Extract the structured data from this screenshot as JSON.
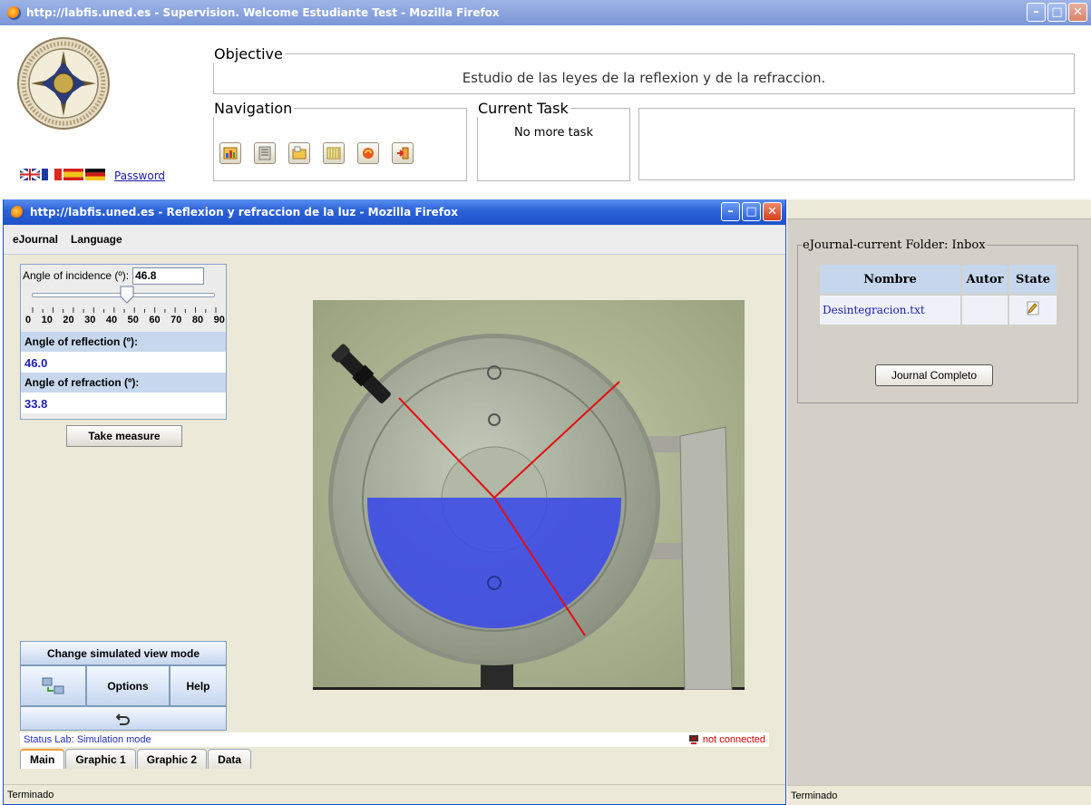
{
  "main_window": {
    "title": "http://labfis.uned.es - Supervision. Welcome Estudiante Test - Mozilla Firefox",
    "password_link": "Password",
    "languages": [
      "en-flag-icon",
      "fr-flag-icon",
      "es-flag-icon",
      "de-flag-icon"
    ],
    "objective": {
      "legend": "Objective",
      "text": "Estudio de las leyes de la reflexion y de la refraccion."
    },
    "navigation": {
      "legend": "Navigation",
      "icons": [
        "lab-icon",
        "document-icon",
        "folder-icon",
        "columns-icon",
        "refresh-icon",
        "exit-icon"
      ]
    },
    "current_task": {
      "legend": "Current Task",
      "text": "No more task"
    },
    "status": "Terminado"
  },
  "lab_window": {
    "title": "http://labfis.uned.es - Reflexion y refraccion de la luz - Mozilla Firefox",
    "menu": [
      "eJournal",
      "Language"
    ],
    "incidence": {
      "label": "Angle of incidence (º):",
      "value": "46.8",
      "slider_min": 0,
      "slider_max": 90,
      "slider_value": 46.8,
      "ticks": [
        "0",
        "10",
        "20",
        "30",
        "40",
        "50",
        "60",
        "70",
        "80",
        "90"
      ]
    },
    "reflection": {
      "label": "Angle of reflection (º):",
      "value": "46.0"
    },
    "refraction": {
      "label": "Angle of refraction (º):",
      "value": "33.8"
    },
    "take_measure": "Take measure",
    "change_view": "Change simulated view mode",
    "options": "Options",
    "help": "Help",
    "status_lab": "Status Lab: Simulation mode",
    "connection": "not connected",
    "tabs": [
      "Main",
      "Graphic 1",
      "Graphic 2",
      "Data"
    ],
    "status": "Terminado"
  },
  "journal_panel": {
    "legend": "eJournal-current Folder: Inbox",
    "columns": [
      "Nombre",
      "Autor",
      "State"
    ],
    "rows": [
      {
        "nombre": "Desintegracion.txt",
        "autor": "",
        "state": "note-icon"
      }
    ],
    "button": "Journal Completo",
    "status": "Terminado"
  },
  "colors": {
    "xp_blue": "#2a61d8",
    "link": "#1a1aa6",
    "water": "#3a4ae8",
    "laser": "#e01010",
    "not_connected": "#d00000"
  }
}
